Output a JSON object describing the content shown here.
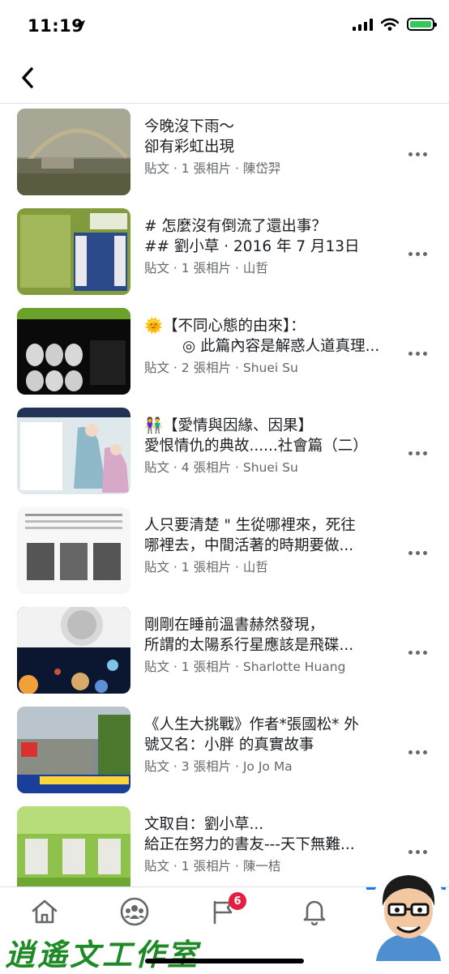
{
  "status_bar": {
    "time": "11:19",
    "icons": [
      "location-arrow-icon",
      "signal-icon",
      "wifi-icon",
      "battery-charging-icon"
    ],
    "battery_color": "#35c759"
  },
  "nav": {
    "back_icon": "chevron-left-icon"
  },
  "posts": [
    {
      "title": "今晚沒下雨～\n卻有彩虹出現",
      "meta": "貼文 · 1 張相片 · 陳岱羿"
    },
    {
      "title": "# 怎麼沒有倒流了還出事？\n## 劉小草 · 2016 年 7 月13日",
      "meta": "貼文 · 1 張相片 · 山哲"
    },
    {
      "title": "🌞【不同心態的由來】：\n        ◎ 此篇內容是解惑人道真理...",
      "meta": "貼文 · 2 張相片 · Shuei Su"
    },
    {
      "title": "👫【愛情與因緣、因果】\n愛恨情仇的典故......社會篇（二）",
      "meta": "貼文 · 4 張相片 · Shuei Su"
    },
    {
      "title": "人只要清楚 \" 生從哪裡來，死往\n哪裡去，中間活著的時期要做...",
      "meta": "貼文 · 1 張相片 · 山哲"
    },
    {
      "title": "剛剛在睡前溫書赫然發現，\n所謂的太陽系行星應該是飛碟...",
      "meta": "貼文 · 1 張相片 · Sharlotte Huang"
    },
    {
      "title": "《人生大挑戰》作者*張國松* 外\n號又名：小胖 的真實故事",
      "meta": "貼文 · 3 張相片 · Jo Jo Ma"
    },
    {
      "title": "文取自：劉小草...\n給正在努力的書友---天下無難...",
      "meta": "貼文 · 1 張相片 · 陳一桔"
    }
  ],
  "tabs": [
    {
      "name": "home",
      "icon": "home-icon"
    },
    {
      "name": "groups",
      "icon": "groups-icon"
    },
    {
      "name": "pages",
      "icon": "flag-icon",
      "badge": "6"
    },
    {
      "name": "notifications",
      "icon": "bell-icon"
    },
    {
      "name": "profile",
      "icon": "avatar"
    }
  ],
  "colors": {
    "accent": "#1877f2",
    "badge": "#e41e3f",
    "watermark": "#1d8a25"
  },
  "watermark": "逍遙文工作室"
}
